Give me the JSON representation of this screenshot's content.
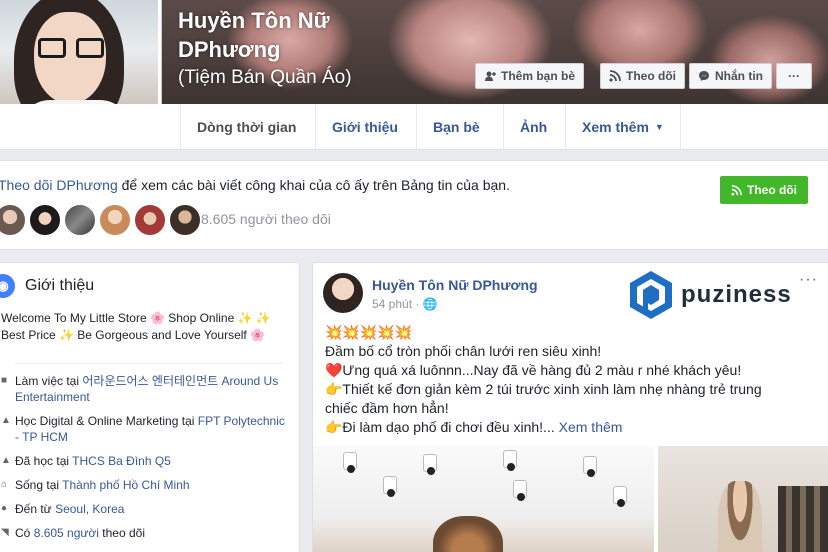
{
  "profile": {
    "name": "Huyền Tôn Nữ DPhương",
    "alternate_name": "(Tiệm Bán Quần Áo)"
  },
  "cover_actions": {
    "add_friend": "Thêm bạn bè",
    "follow": "Theo dõi",
    "message": "Nhắn tin",
    "more": "···"
  },
  "tabs": [
    {
      "label": "Dòng thời gian"
    },
    {
      "label": "Giới thiệu"
    },
    {
      "label": "Bạn bè"
    },
    {
      "label": "Ảnh"
    },
    {
      "label": "Xem thêm"
    }
  ],
  "follow_card": {
    "link_text": "Theo dõi DPhương",
    "rest_text": " để xem các bài viết công khai của cô ấy trên Bảng tin của bạn.",
    "button": "Theo dõi",
    "follower_count": "8.605 người theo dõi"
  },
  "intro": {
    "title": "Giới thiệu",
    "bio_line1": "Welcome To My Little Store 🌸 Shop Online ✨ ✨",
    "bio_line2": "Best Price ✨ Be Gorgeous and Love Yourself 🌸",
    "rows": [
      {
        "prefix": "Làm việc tại ",
        "link": "어라운드어스 엔터테인먼트 Around Us Entertainment",
        "suffix": ""
      },
      {
        "prefix": "Học Digital & Online Marketing tại ",
        "link": "FPT Polytechnic - TP HCM",
        "suffix": ""
      },
      {
        "prefix": "Đã học tại ",
        "link": "THCS Ba Đình Q5",
        "suffix": ""
      },
      {
        "prefix": "Sống tại ",
        "link": "Thành phố Hồ Chí Minh",
        "suffix": ""
      },
      {
        "prefix": "Đến từ ",
        "link": "Seoul, Korea",
        "suffix": ""
      },
      {
        "prefix": "Có ",
        "link": "8.605 người",
        "suffix": " theo dõi"
      }
    ]
  },
  "post": {
    "author": "Huyền Tôn Nữ DPhương",
    "time": "54 phút · ",
    "dots": "···",
    "watermark": "puziness",
    "lines": [
      "💥💥💥💥💥",
      "Đầm bố cổ tròn phối chân lưới ren siêu xinh!",
      "❤️Ưng quá xá luônnn...Nay đã về hàng đủ 2 màu r nhé khách yêu!",
      "👉Thiết kế đơn giản kèm 2 túi trước xinh xinh làm nhẹ nhàng trẻ trung chiếc đầm hơn hẳn!",
      "👉Đi làm dạo phố đi chơi đều xinh!..."
    ],
    "see_more": " Xem thêm"
  }
}
